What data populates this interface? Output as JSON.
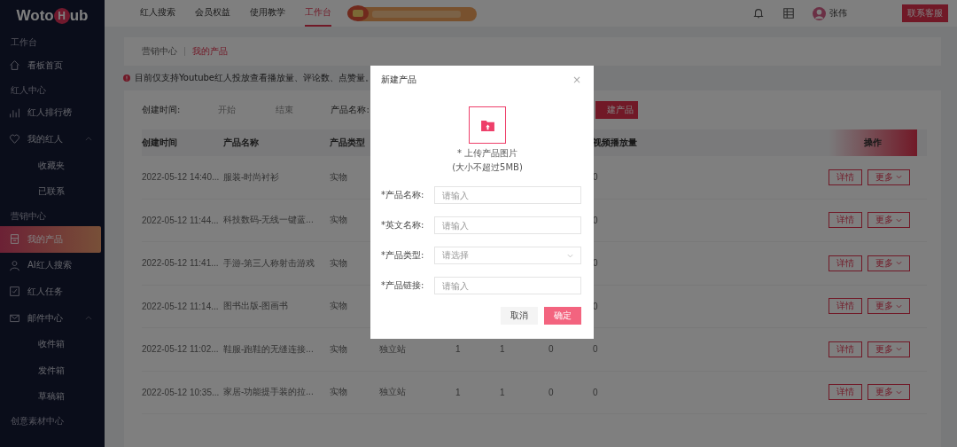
{
  "logo": {
    "before": "Woto",
    "badge": "H",
    "after": "ub"
  },
  "sidebar": {
    "items": [
      {
        "kind": "section",
        "label": "工作台"
      },
      {
        "kind": "item",
        "label": "看板首页",
        "selected": false
      },
      {
        "kind": "section",
        "label": "红人中心"
      },
      {
        "kind": "item",
        "label": "红人排行榜",
        "selected": false
      },
      {
        "kind": "item",
        "label": "我的红人",
        "selected": false,
        "expanded": true
      },
      {
        "kind": "sub",
        "label": "收藏夹",
        "selected": false
      },
      {
        "kind": "sub",
        "label": "已联系",
        "selected": false
      },
      {
        "kind": "section",
        "label": "营销中心"
      },
      {
        "kind": "item",
        "label": "我的产品",
        "selected": true
      },
      {
        "kind": "item",
        "label": "AI红人搜索",
        "selected": false
      },
      {
        "kind": "item",
        "label": "红人任务",
        "selected": false
      },
      {
        "kind": "item",
        "label": "邮件中心",
        "selected": false,
        "expanded": true
      },
      {
        "kind": "sub",
        "label": "收件箱",
        "selected": false
      },
      {
        "kind": "sub",
        "label": "发件箱",
        "selected": false
      },
      {
        "kind": "sub",
        "label": "草稿箱",
        "selected": false
      },
      {
        "kind": "section",
        "label": "创意素材中心"
      }
    ]
  },
  "top_nav": {
    "tabs": [
      {
        "label": "红人搜索",
        "selected": false
      },
      {
        "label": "会员权益",
        "selected": false
      },
      {
        "label": "使用教学",
        "selected": false
      },
      {
        "label": "工作台",
        "selected": true
      }
    ],
    "user": "张伟",
    "button": "联系客服"
  },
  "breadcrumb": [
    "营销中心",
    "我的产品"
  ],
  "notice": "目前仅支持Youtube红人投放查看播放量、评论数、点赞量。",
  "filters": {
    "date_label": "创建时间:",
    "start": "开始",
    "end": "结束",
    "name_label": "产品名称:",
    "new_button": "建产品"
  },
  "table": {
    "columns": [
      "创建时间",
      "产品名称",
      "产品类型",
      "视频播放量",
      "操作"
    ],
    "rows": [
      {
        "created": "2022-05-12 14:40...",
        "name": "服装-时尚衬衫",
        "type": "实物",
        "views": "0",
        "actions": [
          "详情",
          "更多"
        ]
      },
      {
        "created": "2022-05-12 11:44...",
        "name": "科技数码-无线一键蓝...",
        "type": "实物",
        "views": "0",
        "actions": [
          "详情",
          "更多"
        ]
      },
      {
        "created": "2022-05-12 11:41...",
        "name": "手游-第三人称射击游戏",
        "type": "实物",
        "views": "0",
        "actions": [
          "详情",
          "更多"
        ]
      },
      {
        "created": "2022-05-12 11:14...",
        "name": "图书出版-图画书",
        "type": "实物",
        "views": "0",
        "actions": [
          "详情",
          "更多"
        ]
      },
      {
        "created": "2022-05-12 11:02...",
        "name": "鞋服-跑鞋的无缝连接...",
        "type": "实物",
        "column_4": "独立站",
        "column_5": "1",
        "column_6": "1",
        "column_7": "0",
        "views": "0",
        "actions": [
          "详情",
          "更多"
        ]
      },
      {
        "created": "2022-05-12 10:35...",
        "name": "家居-功能提手装的拉...",
        "type": "实物",
        "column_4": "独立站",
        "column_5": "1",
        "column_6": "1",
        "column_7": "0",
        "views": "0",
        "actions": [
          "详情",
          "更多"
        ]
      }
    ]
  },
  "dialog": {
    "title": "新建产品",
    "close": "×",
    "upload_label": "* 上传产品图片",
    "upload_hint": "(大小不超过5MB)",
    "fields": [
      {
        "label": "*产品名称:",
        "kind": "input",
        "placeholder": "请输入"
      },
      {
        "label": "*英文名称:",
        "kind": "input",
        "placeholder": "请输入"
      },
      {
        "label": "*产品类型:",
        "kind": "select",
        "placeholder": "请选择"
      },
      {
        "label": "*产品链接:",
        "kind": "input",
        "placeholder": "请输入"
      }
    ],
    "buttons": [
      "取消",
      "确定"
    ]
  }
}
